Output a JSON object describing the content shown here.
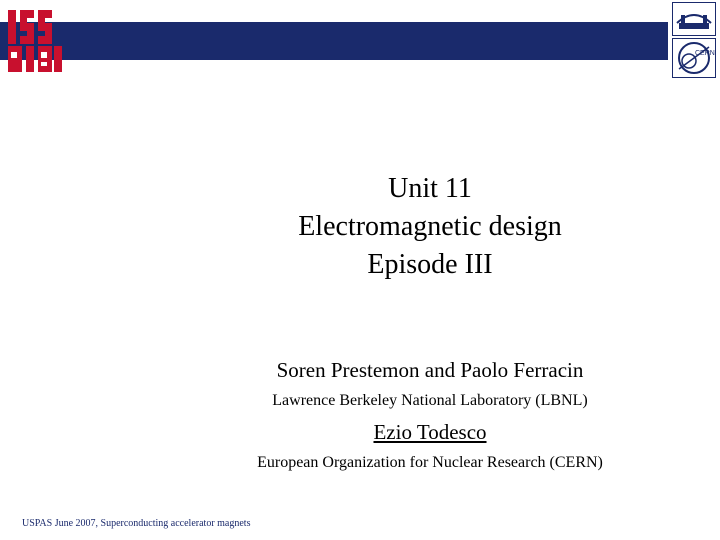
{
  "title": {
    "line1": "Unit 11",
    "line2": "Electromagnetic design",
    "line3": "Episode III"
  },
  "authors": {
    "primary": "Soren Prestemon and Paolo Ferracin",
    "primary_affiliation": "Lawrence Berkeley National Laboratory (LBNL)",
    "secondary": "Ezio Todesco",
    "secondary_affiliation": "European Organization for Nuclear Research (CERN)"
  },
  "footer": {
    "text": "USPAS June  2007,  Superconducting accelerator magnets"
  },
  "logos": {
    "uspas_text": "USPAS",
    "cern_text": "CERN"
  },
  "colors": {
    "band": "#1a2a6c",
    "logo_red": "#c8102e"
  }
}
